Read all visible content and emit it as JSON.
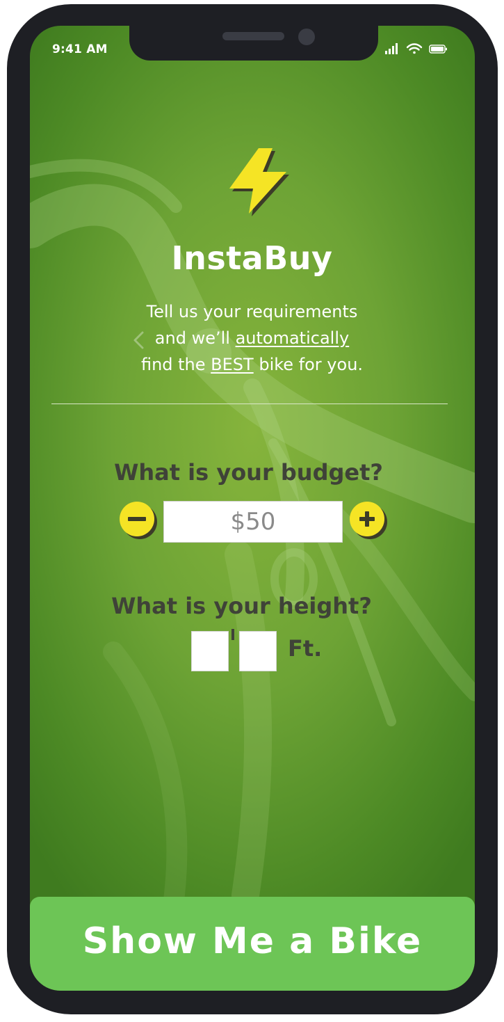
{
  "status_bar": {
    "time": "9:41 AM"
  },
  "app": {
    "name": "InstaBuy",
    "tagline": {
      "line1": "Tell us your requirements",
      "line2_prefix": "and we’ll ",
      "line2_link": "automatically",
      "line3_prefix": "find the ",
      "line3_emphasis": "BEST",
      "line3_suffix": " bike for you."
    }
  },
  "budget": {
    "question": "What is your budget?",
    "value": "$50",
    "decrement_symbol": "−",
    "increment_symbol": "+"
  },
  "height": {
    "question": "What is your height?",
    "feet_value": "",
    "inches_value": "",
    "unit": "Ft."
  },
  "cta": {
    "label": "Show Me a Bike"
  },
  "icons": {
    "logo": "lightning-bolt-icon",
    "back": "chevron-left-icon",
    "signal": "cellular-signal-icon",
    "wifi": "wifi-icon",
    "battery": "battery-icon"
  },
  "colors": {
    "accent_yellow": "#f5e425",
    "background_green": "#6da335",
    "cta_green": "#6dc556",
    "device_frame": "#1e1f24",
    "label_dark": "#3f4238"
  }
}
